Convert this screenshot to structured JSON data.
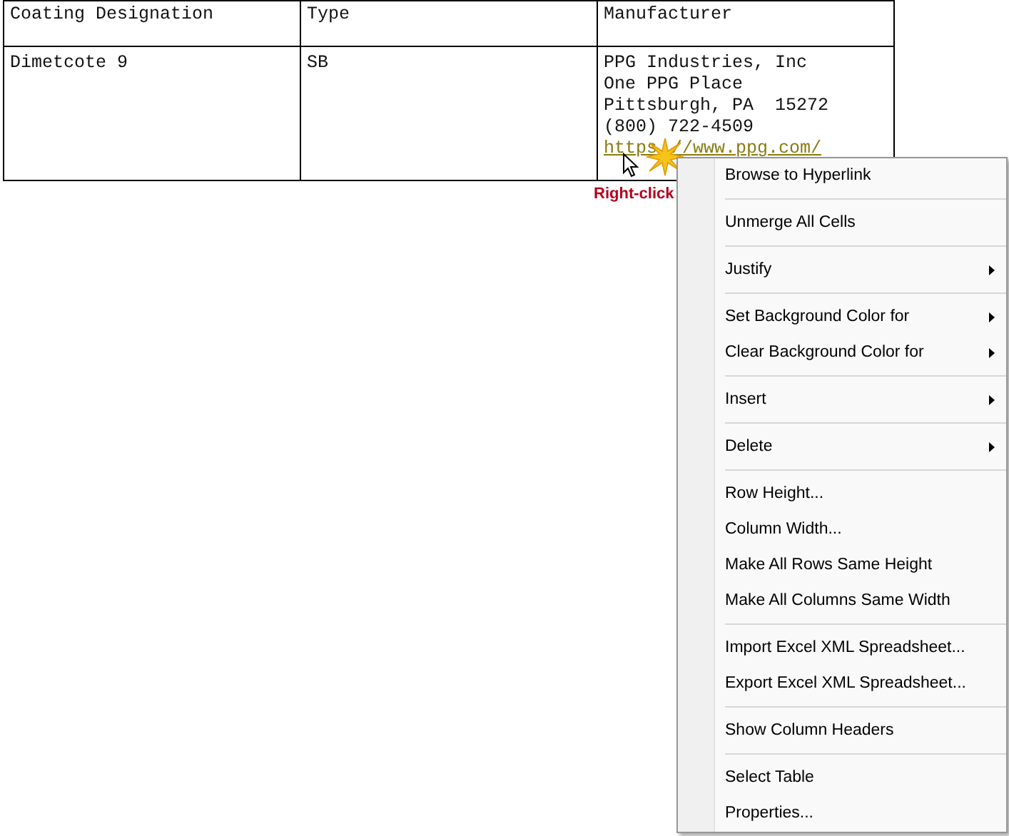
{
  "table": {
    "columns": [
      "Coating Designation",
      "Type",
      "Manufacturer"
    ],
    "rows": [
      {
        "coating_designation": "Dimetcote 9",
        "type": "SB",
        "manufacturer_lines": [
          "PPG Industries, Inc",
          "One PPG Place",
          "Pittsburgh, PA  15272",
          "(800) 722-4509"
        ],
        "manufacturer_link_parts": [
          "https",
          "//www.ppg.com/"
        ]
      }
    ]
  },
  "callout": "Right-click",
  "context_menu": {
    "groups": [
      [
        {
          "label": "Browse to Hyperlink",
          "submenu": false
        }
      ],
      [
        {
          "label": "Unmerge All Cells",
          "submenu": false
        }
      ],
      [
        {
          "label": "Justify",
          "submenu": true
        }
      ],
      [
        {
          "label": "Set Background Color for",
          "submenu": true
        },
        {
          "label": "Clear Background Color for",
          "submenu": true
        }
      ],
      [
        {
          "label": "Insert",
          "submenu": true
        }
      ],
      [
        {
          "label": "Delete",
          "submenu": true
        }
      ],
      [
        {
          "label": "Row Height...",
          "submenu": false
        },
        {
          "label": "Column Width...",
          "submenu": false
        },
        {
          "label": "Make All Rows Same Height",
          "submenu": false
        },
        {
          "label": "Make All Columns Same Width",
          "submenu": false
        }
      ],
      [
        {
          "label": "Import Excel XML Spreadsheet...",
          "submenu": false
        },
        {
          "label": "Export Excel XML Spreadsheet...",
          "submenu": false
        }
      ],
      [
        {
          "label": "Show Column Headers",
          "submenu": false
        }
      ],
      [
        {
          "label": "Select Table",
          "submenu": false
        },
        {
          "label": "Properties...",
          "submenu": false
        }
      ]
    ]
  }
}
